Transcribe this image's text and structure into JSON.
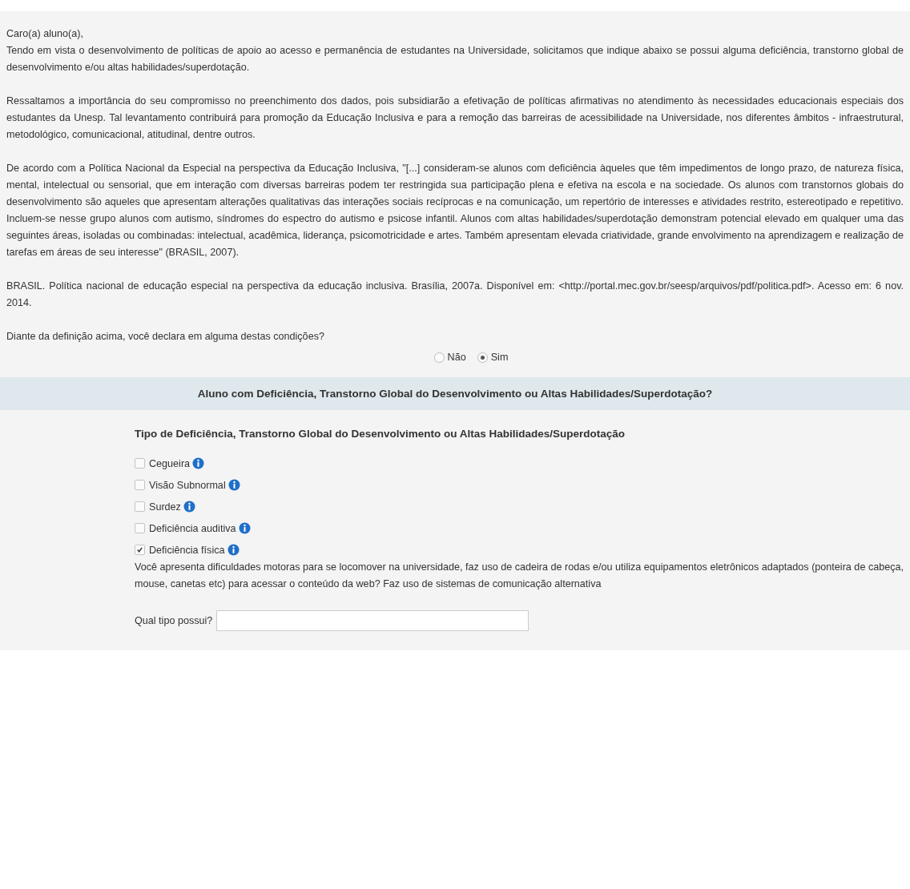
{
  "intro": {
    "greeting": "Caro(a) aluno(a),",
    "paragraphs": [
      "Tendo em vista o desenvolvimento de políticas de apoio ao acesso e permanência de estudantes na Universidade, solicitamos que indique abaixo se possui alguma deficiência, transtorno global de desenvolvimento e/ou altas habilidades/superdotação.",
      "Ressaltamos a importância do seu compromisso no preenchimento dos dados, pois subsidiarão a efetivação de políticas afirmativas no atendimento às necessidades educacionais especiais dos estudantes da Unesp. Tal levantamento contribuirá para promoção da Educação Inclusiva e para a remoção das barreiras de acessibilidade na Universidade, nos diferentes âmbitos - infraestrutural, metodológico, comunicacional, atitudinal, dentre outros.",
      "De acordo com a Política Nacional da Especial na perspectiva da Educação Inclusiva, \"[...] consideram-se alunos com deficiência àqueles que têm impedimentos de longo prazo, de natureza física, mental, intelectual ou sensorial, que em interação com diversas barreiras podem ter restringida sua participação plena e efetiva na escola e na sociedade. Os alunos com transtornos globais do desenvolvimento são aqueles que apresentam alterações qualitativas das interações sociais recíprocas e na comunicação, um repertório de interesses e atividades restrito, estereotipado e repetitivo. Incluem-se nesse grupo alunos com autismo, síndromes do espectro do autismo e psicose infantil. Alunos com altas habilidades/superdotação demonstram potencial elevado em qualquer uma das seguintes áreas, isoladas ou combinadas: intelectual, acadêmica, liderança, psicomotricidade e artes. Também apresentam elevada criatividade, grande envolvimento na aprendizagem e realização de tarefas em áreas de seu interesse\" (BRASIL, 2007).",
      "BRASIL. Política nacional de educação especial na perspectiva da educação inclusiva. Brasília, 2007a. Disponível em: <http://portal.mec.gov.br/seesp/arquivos/pdf/politica.pdf>. Acesso em: 6 nov. 2014."
    ]
  },
  "question": {
    "text": "Diante da definição acima, você declara em alguma destas condições?",
    "options": [
      {
        "label": "Não",
        "selected": false
      },
      {
        "label": "Sim",
        "selected": true
      }
    ]
  },
  "section": {
    "title": "Aluno com Deficiência, Transtorno Global do Desenvolvimento ou Altas Habilidades/Superdotação?",
    "subtitle": "Tipo de Deficiência, Transtorno Global do Desenvolvimento ou Altas Habilidades/Superdotação",
    "items": [
      {
        "label": "Cegueira",
        "checked": false
      },
      {
        "label": "Visão Subnormal",
        "checked": false
      },
      {
        "label": "Surdez",
        "checked": false
      },
      {
        "label": "Deficiência auditiva",
        "checked": false
      },
      {
        "label": "Deficiência física",
        "checked": true
      }
    ],
    "description": "Você apresenta dificuldades motoras para se locomover na universidade, faz uso de cadeira de rodas e/ou utiliza equipamentos eletrônicos adaptados (ponteira de cabeça, mouse, canetas etc) para acessar o conteúdo da web? Faz uso de sistemas de comunicação alternativa",
    "field": {
      "label": "Qual tipo possui?"
    }
  }
}
